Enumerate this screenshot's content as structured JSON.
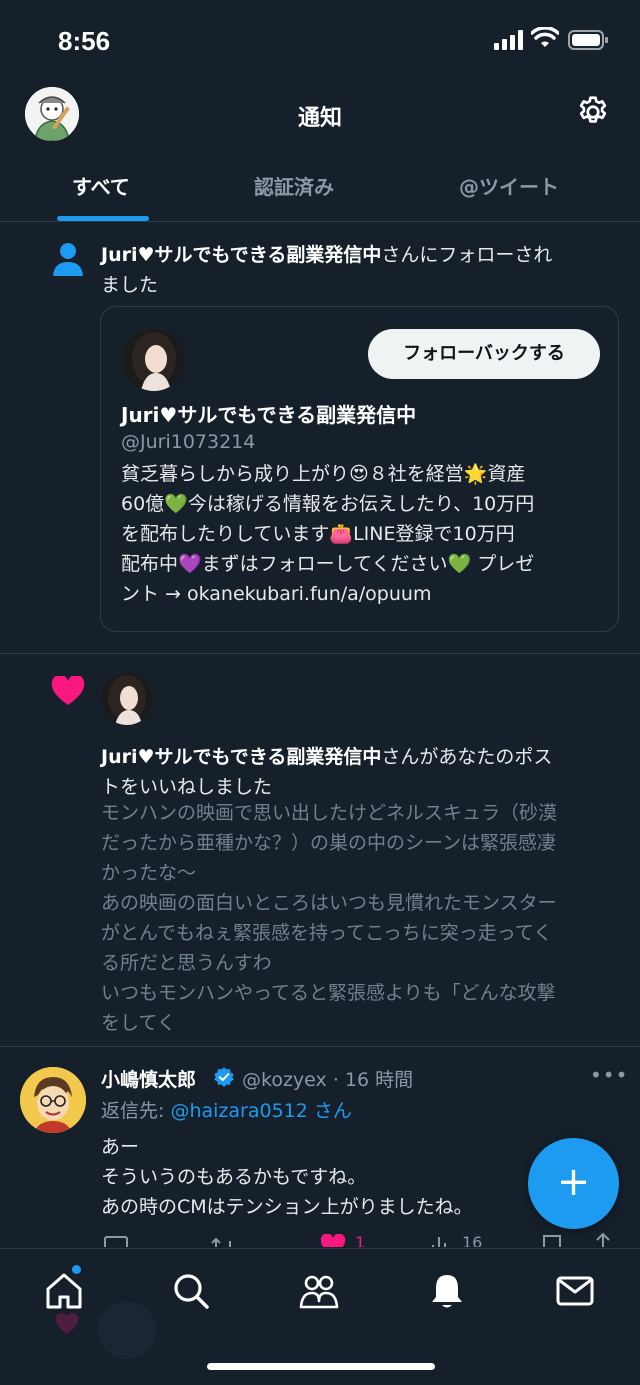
{
  "status_bar": {
    "time": "8:56"
  },
  "header": {
    "title": "通知"
  },
  "tabs": [
    {
      "label": "すべて",
      "active": true
    },
    {
      "label": "認証済み",
      "active": false
    },
    {
      "label": "@ツイート",
      "active": false
    }
  ],
  "follow_notification": {
    "user_name": "Juri♥サルでもできる副業発信中",
    "text_suffix": "さんにフォローされ",
    "text_line2": "ました",
    "card": {
      "follow_back_label": "フォローバックする",
      "name": "Juri♥サルでもできる副業発信中",
      "handle": "@Juri1073214",
      "bio_lines": [
        "貧乏暮らしから成り上がり😍８社を経営🌟資産",
        "60億💚今は稼げる情報をお伝えしたり、10万円",
        "を配布したりしています👛LINE登録で10万円",
        "配布中💜まずはフォローしてください💚 プレゼ",
        "ント → okanekubari.fun/a/opuum"
      ]
    }
  },
  "like_notification": {
    "user_name": "Juri♥サルでもできる副業発信中",
    "text_suffix": "さんがあなたのポス",
    "text_line2": "トをいいねしました",
    "post_lines": [
      "モンハンの映画で思い出したけどネルスキュラ（砂漠",
      "だったから亜種かな？）の巣の中のシーンは緊張感凄",
      "かったな〜",
      "あの映画の面白いところはいつも見慣れたモンスター",
      "がとんでもねぇ緊張感を持ってこっちに突っ走ってく",
      "る所だと思うんすわ",
      "いつもモンハンやってると緊張感よりも「どんな攻撃",
      "をしてく"
    ]
  },
  "tweet": {
    "name": "小嶋慎太郎",
    "handle": "@kozyex",
    "separator": "·",
    "time": "16 時間",
    "more": "•••",
    "reply_prefix": "返信先: ",
    "reply_to": "@haizara0512 さん",
    "body_lines": [
      "あー",
      "そういうのもあるかもですね。",
      "あの時のCMはテンション上がりましたね。"
    ],
    "likes": "1",
    "views": "16"
  },
  "fab": {
    "label": "+"
  },
  "colors": {
    "background": "#15202b",
    "accent": "#1d9bf0",
    "like": "#f91880",
    "muted": "#8b98a5"
  },
  "icons": [
    "signal-icon",
    "wifi-icon",
    "battery-icon",
    "gear-icon",
    "person-icon",
    "heart-icon",
    "verified-icon",
    "home-icon",
    "search-icon",
    "communities-icon",
    "bell-icon",
    "mail-icon"
  ]
}
